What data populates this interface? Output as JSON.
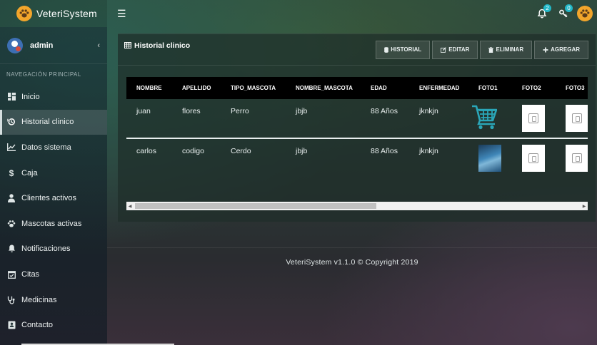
{
  "app": {
    "brand": "VeteriSystem"
  },
  "topbar": {
    "notifications_count": "2",
    "keys_count": "0"
  },
  "user": {
    "name": "admin"
  },
  "sidebar": {
    "header": "NAVEGACIÓN PRINCIPAL",
    "items": [
      {
        "label": "Inicio",
        "icon": "dashboard-icon",
        "active": false
      },
      {
        "label": "Historial clinico",
        "icon": "history-icon",
        "active": true
      },
      {
        "label": "Datos sistema",
        "icon": "line-chart-icon",
        "active": false
      },
      {
        "label": "Caja",
        "icon": "dollar-icon",
        "active": false
      },
      {
        "label": "Clientes activos",
        "icon": "user-icon",
        "active": false
      },
      {
        "label": "Mascotas activas",
        "icon": "paw-icon",
        "active": false
      },
      {
        "label": "Notificaciones",
        "icon": "bell-icon",
        "active": false
      },
      {
        "label": "Citas",
        "icon": "calendar-icon",
        "active": false
      },
      {
        "label": "Medicinas",
        "icon": "stethoscope-icon",
        "active": false
      },
      {
        "label": "Contacto",
        "icon": "contact-icon",
        "active": false
      }
    ]
  },
  "box": {
    "title": "Historial clinico",
    "buttons": {
      "historial": "HISTORIAL",
      "editar": "EDITAR",
      "eliminar": "ELIMINAR",
      "agregar": "AGREGAR"
    }
  },
  "table": {
    "headers": [
      "NOMBRE",
      "APELLIDO",
      "TIPO_MASCOTA",
      "NOMBRE_MASCOTA",
      "EDAD",
      "ENFERMEDAD",
      "FOTO1",
      "FOTO2",
      "FOTO3"
    ],
    "rows": [
      {
        "nombre": "juan",
        "apellido": "flores",
        "tipo": "Perro",
        "mascota": "jbjb",
        "edad": "88 Años",
        "enfermedad": "jknkjn",
        "foto1": "shopping-cart-image"
      },
      {
        "nombre": "carlos",
        "apellido": "codigo",
        "tipo": "Cerdo",
        "mascota": "jbjb",
        "edad": "88 Años",
        "enfermedad": "jknkjn",
        "foto1": "ocean-image"
      }
    ]
  },
  "footer": {
    "text": "VeteriSystem v1.1.0 © Copyright 2019"
  },
  "colors": {
    "accent_badge": "#22b8c8",
    "logo_orange": "#f2a52b"
  }
}
